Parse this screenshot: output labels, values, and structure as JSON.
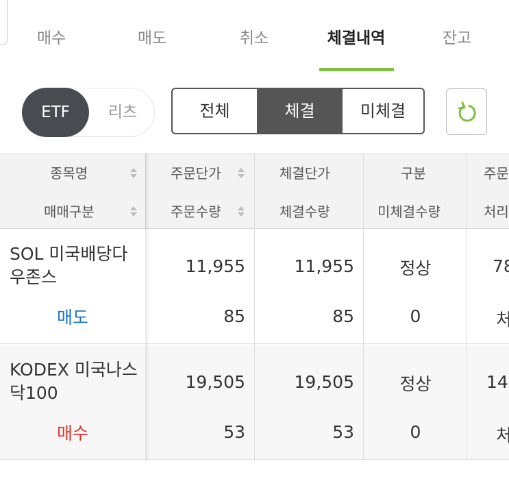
{
  "tabs": [
    {
      "label": "매수",
      "active": false
    },
    {
      "label": "매도",
      "active": false
    },
    {
      "label": "취소",
      "active": false
    },
    {
      "label": "체결내역",
      "active": true
    },
    {
      "label": "잔고",
      "active": false
    }
  ],
  "asset_toggle": {
    "options": [
      "ETF",
      "리츠"
    ],
    "selected": "ETF"
  },
  "filter": {
    "options": [
      "전체",
      "체결",
      "미체결"
    ],
    "selected": "체결"
  },
  "refresh_icon": "refresh-icon",
  "colors": {
    "accent": "#7fbf3f",
    "sell": "#1a73c9",
    "buy": "#e0312b",
    "dark": "#484c51"
  },
  "table": {
    "headers": {
      "col1_top": "종목명",
      "col1_bottom": "매매구분",
      "col2_top": "주문단가",
      "col2_bottom": "주문수량",
      "col3_top": "체결단가",
      "col3_bottom": "체결수량",
      "col4_top": "구분",
      "col4_bottom": "미체결수량",
      "col5_top": "주문",
      "col5_bottom": "처리"
    },
    "rows": [
      {
        "name": "SOL 미국배당다우존스",
        "trade_type": "매도",
        "order_price": "11,955",
        "order_qty": "85",
        "exec_price": "11,955",
        "exec_qty": "85",
        "status": "정상",
        "unfilled_qty": "0",
        "col5_top": "78",
        "col5_bottom": "처"
      },
      {
        "name": "KODEX 미국나스닥100",
        "trade_type": "매수",
        "order_price": "19,505",
        "order_qty": "53",
        "exec_price": "19,505",
        "exec_qty": "53",
        "status": "정상",
        "unfilled_qty": "0",
        "col5_top": "14",
        "col5_bottom": "처"
      }
    ]
  }
}
